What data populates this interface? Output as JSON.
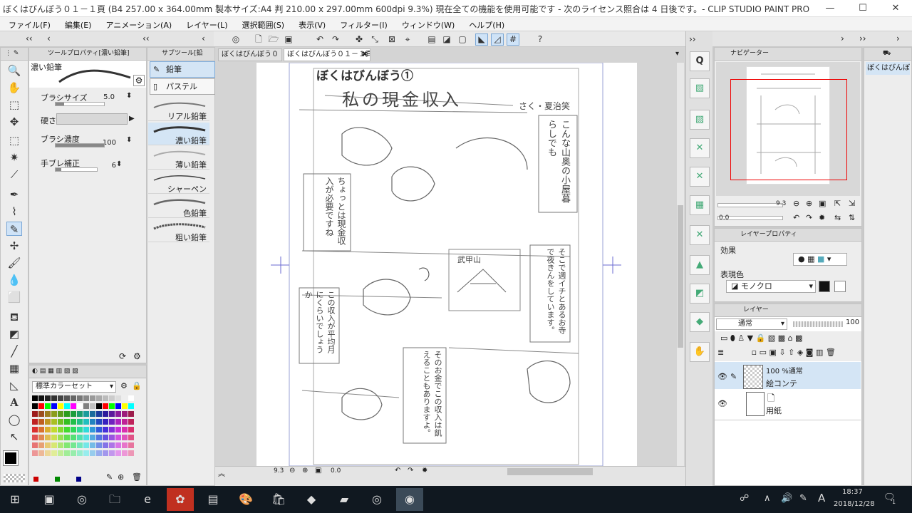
{
  "window": {
    "title": "ぼくはびんぼう０１－１頁 (B4 257.00 x 364.00mm 製本サイズ:A4 判 210.00 x 297.00mm 600dpi 9.3%)  現在全ての機能を使用可能です - 次のライセンス照合は 4 日後です。- CLIP STUDIO PAINT PRO",
    "minimize": "—",
    "maximize": "☐",
    "close": "✕"
  },
  "menu": [
    "ファイル(F)",
    "編集(E)",
    "アニメーション(A)",
    "レイヤー(L)",
    "選択範囲(S)",
    "表示(V)",
    "フィルター(I)",
    "ウィンドウ(W)",
    "ヘルプ(H)"
  ],
  "tool_property": {
    "tab": "ツールプロパティ[濃い鉛筆]",
    "brush_name": "濃い鉛筆",
    "brush_size_label": "ブラシサイズ",
    "brush_size": "5.0",
    "hardness_label": "硬さ",
    "density_label": "ブラシ濃度",
    "density": "100",
    "stabilization_label": "手ブレ補正",
    "stabilization": "6"
  },
  "sub_tool": {
    "tab": "サブツール[鉛",
    "groups": [
      "鉛筆",
      "パステル"
    ],
    "brushes": [
      "リアル鉛筆",
      "濃い鉛筆",
      "薄い鉛筆",
      "シャーペン",
      "色鉛筆",
      "粗い鉛筆"
    ]
  },
  "color_set": {
    "name": "標準カラーセット",
    "colors": [
      "#000000",
      "#ff0000",
      "#00ff00",
      "#0000ff",
      "#ffff00",
      "#00ffff",
      "#ff00ff",
      "#ffffff",
      "#808080",
      "#c0c0c0"
    ]
  },
  "canvas_tabs": [
    "ぼくはびんぼう０",
    "ぼくはびんぼう０１－１頁"
  ],
  "page_content": {
    "title": "ぼくはびんぼう①",
    "chapter": "私の現金収入",
    "author": "さく・夏治笑",
    "balloons": [
      "こんな山奥の小屋暮らしでも",
      "ちょっとは現金収入が必要ですね",
      "そこで週イチとあるお寺で夜きんをしています。",
      "この収入が平均月にくらいでしょうか",
      "そのお金でこの収入は飢えることもありますよ。",
      "武甲山"
    ]
  },
  "status": {
    "zoom": "9.3",
    "angle": "0.0"
  },
  "navigator": {
    "tab": "ナビゲーター",
    "zoom": "9.3",
    "angle": "0.0"
  },
  "layer_property": {
    "tab": "レイヤープロパティ",
    "effect_label": "効果",
    "expression_label": "表現色",
    "expression_value": "モノクロ"
  },
  "layers": {
    "tab": "レイヤー",
    "blend_mode": "通常",
    "opacity": "100",
    "items": [
      {
        "title": "100 %通常",
        "name": "絵コンテ"
      },
      {
        "title": "",
        "name": "用紙"
      }
    ]
  },
  "side_label": "ぼくはびんぼ",
  "clock": {
    "time": "18:37",
    "date": "2018/12/28"
  },
  "ime": "A",
  "notification_count": "1"
}
